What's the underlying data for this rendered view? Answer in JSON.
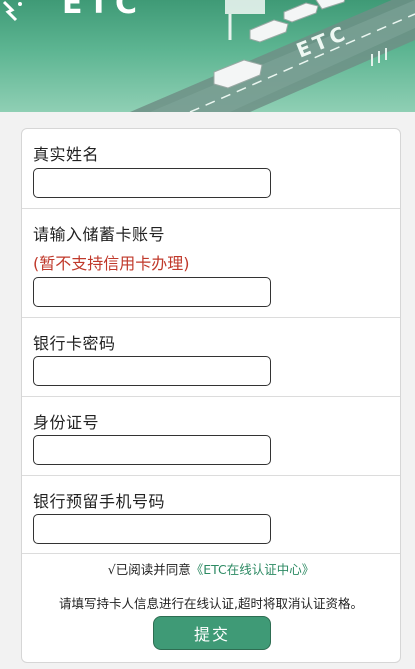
{
  "banner": {
    "logo_text": "ETC",
    "road_text": "ETC"
  },
  "form": {
    "fields": [
      {
        "label": "真实姓名",
        "value": "",
        "note": ""
      },
      {
        "label": "请输入储蓄卡账号",
        "value": "",
        "note": "(暂不支持信用卡办理)"
      },
      {
        "label": "银行卡密码",
        "value": "",
        "note": ""
      },
      {
        "label": "身份证号",
        "value": "",
        "note": ""
      },
      {
        "label": "银行预留手机号码",
        "value": "",
        "note": ""
      }
    ],
    "agree_prefix": "√已阅读并同意",
    "agree_link": "《ETC在线认证中心》",
    "tip": "请填写持卡人信息进行在线认证,超时将取消认证资格。",
    "submit_label": "提交"
  },
  "colors": {
    "brand_green": "#3f9a76",
    "note_red": "#c0392b"
  }
}
